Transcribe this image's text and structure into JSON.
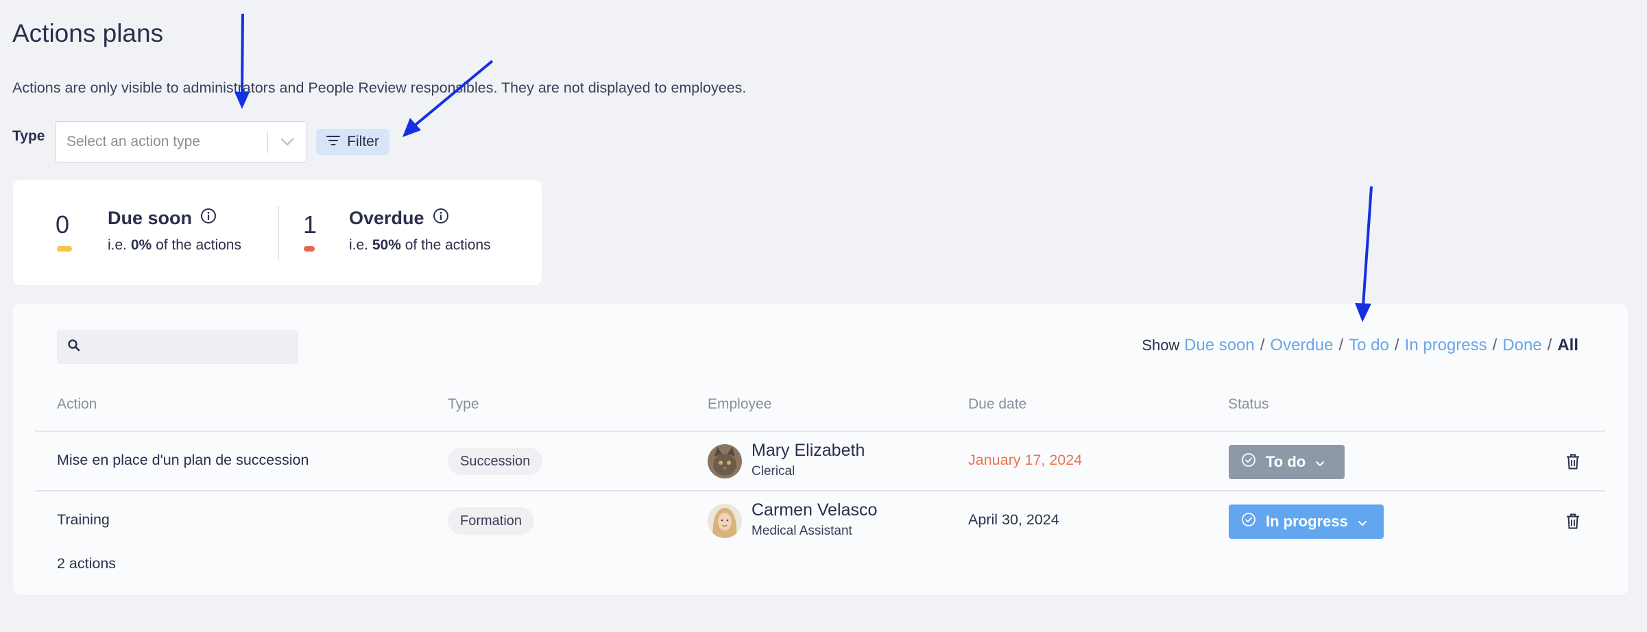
{
  "page": {
    "title": "Actions plans",
    "notice": "Actions are only visible to administrators and People Review responsibles. They are not displayed to employees."
  },
  "filters": {
    "type_label": "Type",
    "type_placeholder": "Select an action type",
    "filter_label": "Filter"
  },
  "summary": {
    "due_soon": {
      "count": "0",
      "label": "Due soon",
      "prefix": "i.e.",
      "percent": "0%",
      "suffix": "of the actions",
      "color": "#f5c54b"
    },
    "overdue": {
      "count": "1",
      "label": "Overdue",
      "prefix": "i.e.",
      "percent": "50%",
      "suffix": "of the actions",
      "color": "#e8684f"
    }
  },
  "table": {
    "show_label": "Show",
    "show_links": [
      "Due soon",
      "Overdue",
      "To do",
      "In progress",
      "Done"
    ],
    "show_active": "All",
    "columns": [
      "Action",
      "Type",
      "Employee",
      "Due date",
      "Status"
    ],
    "rows": [
      {
        "action": "Mise en place d'un plan de succession",
        "type": "Succession",
        "employee_name": "Mary Elizabeth",
        "employee_role": "Clerical",
        "due_date": "January 17, 2024",
        "due_color": "#e8774f",
        "status": "To do",
        "status_color": "#8e99a8"
      },
      {
        "action": "Training",
        "type": "Formation",
        "employee_name": "Carmen Velasco",
        "employee_role": "Medical Assistant",
        "due_date": "April 30, 2024",
        "due_color": "#2b2f4c",
        "status": "In progress",
        "status_color": "#62a6f0"
      }
    ],
    "count_text": "2 actions"
  },
  "icons": {
    "chevron": "chevron-down-icon",
    "filter": "filter-icon",
    "info": "info-icon",
    "search": "search-icon",
    "check": "check-circle-icon",
    "trash": "trash-icon"
  },
  "annotation_color": "#1630e0"
}
